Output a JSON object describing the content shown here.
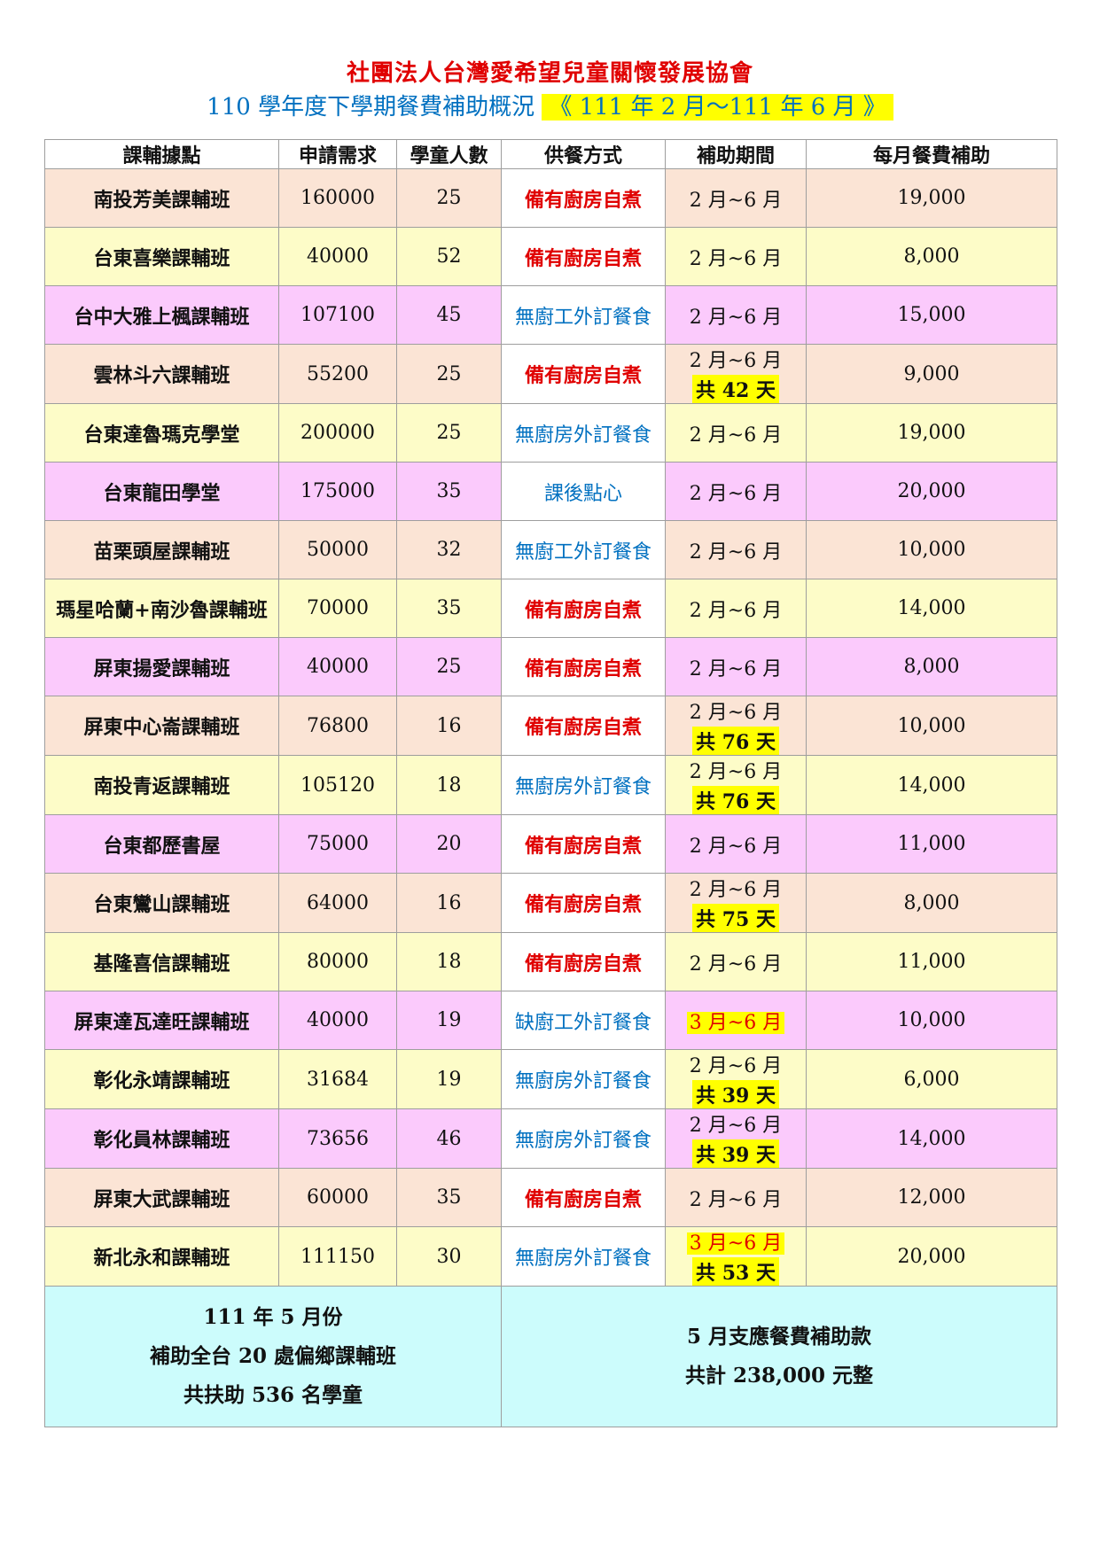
{
  "header": {
    "org": "社團法人台灣愛希望兒童關懷發展協會",
    "subtitle": "110 學年度下學期餐費補助概況",
    "period": "《 111 年 2 月～111 年 6 月 》"
  },
  "table": {
    "columns": [
      "課輔據點",
      "申請需求",
      "學童人數",
      "供餐方式",
      "補助期間",
      "每月餐費補助"
    ],
    "rows": [
      {
        "name": "南投芳美課輔班",
        "request": "160000",
        "students": "25",
        "meal": "備有廚房自煮",
        "meal_color": "red",
        "period": "2 月~6 月",
        "days": "",
        "period_hl": false,
        "monthly": "19,000",
        "band": "r0"
      },
      {
        "name": "台東喜樂課輔班",
        "request": "40000",
        "students": "52",
        "meal": "備有廚房自煮",
        "meal_color": "red",
        "period": "2 月~6 月",
        "days": "",
        "period_hl": false,
        "monthly": "8,000",
        "band": "r1"
      },
      {
        "name": "台中大雅上楓課輔班",
        "request": "107100",
        "students": "45",
        "meal": "無廚工外訂餐食",
        "meal_color": "blue",
        "period": "2 月~6 月",
        "days": "",
        "period_hl": false,
        "monthly": "15,000",
        "band": "r2"
      },
      {
        "name": "雲林斗六課輔班",
        "request": "55200",
        "students": "25",
        "meal": "備有廚房自煮",
        "meal_color": "red",
        "period": "2 月~6 月",
        "days": "共 42 天",
        "period_hl": false,
        "monthly": "9,000",
        "band": "r0"
      },
      {
        "name": "台東達魯瑪克學堂",
        "request": "200000",
        "students": "25",
        "meal": "無廚房外訂餐食",
        "meal_color": "blue",
        "period": "2 月~6 月",
        "days": "",
        "period_hl": false,
        "monthly": "19,000",
        "band": "r1"
      },
      {
        "name": "台東龍田學堂",
        "request": "175000",
        "students": "35",
        "meal": "課後點心",
        "meal_color": "blue",
        "period": "2 月~6 月",
        "days": "",
        "period_hl": false,
        "monthly": "20,000",
        "band": "r2"
      },
      {
        "name": "苗栗頭屋課輔班",
        "request": "50000",
        "students": "32",
        "meal": "無廚工外訂餐食",
        "meal_color": "blue",
        "period": "2 月~6 月",
        "days": "",
        "period_hl": false,
        "monthly": "10,000",
        "band": "r0"
      },
      {
        "name": "瑪星哈蘭+南沙魯課輔班",
        "request": "70000",
        "students": "35",
        "meal": "備有廚房自煮",
        "meal_color": "red",
        "period": "2 月~6 月",
        "days": "",
        "period_hl": false,
        "monthly": "14,000",
        "band": "r1"
      },
      {
        "name": "屏東揚愛課輔班",
        "request": "40000",
        "students": "25",
        "meal": "備有廚房自煮",
        "meal_color": "red",
        "period": "2 月~6 月",
        "days": "",
        "period_hl": false,
        "monthly": "8,000",
        "band": "r2"
      },
      {
        "name": "屏東中心崙課輔班",
        "request": "76800",
        "students": "16",
        "meal": "備有廚房自煮",
        "meal_color": "red",
        "period": "2 月~6 月",
        "days": "共 76 天",
        "period_hl": false,
        "monthly": "10,000",
        "band": "r0"
      },
      {
        "name": "南投青返課輔班",
        "request": "105120",
        "students": "18",
        "meal": "無廚房外訂餐食",
        "meal_color": "blue",
        "period": "2 月~6 月",
        "days": "共 76 天",
        "period_hl": false,
        "monthly": "14,000",
        "band": "r1"
      },
      {
        "name": "台東都歷書屋",
        "request": "75000",
        "students": "20",
        "meal": "備有廚房自煮",
        "meal_color": "red",
        "period": "2 月~6 月",
        "days": "",
        "period_hl": false,
        "monthly": "11,000",
        "band": "r2"
      },
      {
        "name": "台東鸞山課輔班",
        "request": "64000",
        "students": "16",
        "meal": "備有廚房自煮",
        "meal_color": "red",
        "period": "2 月~6 月",
        "days": "共 75 天",
        "period_hl": false,
        "monthly": "8,000",
        "band": "r0"
      },
      {
        "name": "基隆喜信課輔班",
        "request": "80000",
        "students": "18",
        "meal": "備有廚房自煮",
        "meal_color": "red",
        "period": "2 月~6 月",
        "days": "",
        "period_hl": false,
        "monthly": "11,000",
        "band": "r1"
      },
      {
        "name": "屏東達瓦達旺課輔班",
        "request": "40000",
        "students": "19",
        "meal": "缺廚工外訂餐食",
        "meal_color": "blue",
        "period": "3 月~6 月",
        "days": "",
        "period_hl": true,
        "monthly": "10,000",
        "band": "r2"
      },
      {
        "name": "彰化永靖課輔班",
        "request": "31684",
        "students": "19",
        "meal": "無廚房外訂餐食",
        "meal_color": "blue",
        "period": "2 月~6 月",
        "days": "共 39 天",
        "period_hl": false,
        "monthly": "6,000",
        "band": "r1"
      },
      {
        "name": "彰化員林課輔班",
        "request": "73656",
        "students": "46",
        "meal": "無廚房外訂餐食",
        "meal_color": "blue",
        "period": "2 月~6 月",
        "days": "共 39 天",
        "period_hl": false,
        "monthly": "14,000",
        "band": "r2"
      },
      {
        "name": "屏東大武課輔班",
        "request": "60000",
        "students": "35",
        "meal": "備有廚房自煮",
        "meal_color": "red",
        "period": "2 月~6 月",
        "days": "",
        "period_hl": false,
        "monthly": "12,000",
        "band": "r0"
      },
      {
        "name": "新北永和課輔班",
        "request": "111150",
        "students": "30",
        "meal": "無廚房外訂餐食",
        "meal_color": "blue",
        "period": "3 月~6 月",
        "days": "共 53 天",
        "period_hl": true,
        "monthly": "20,000",
        "band": "r1"
      }
    ]
  },
  "summary": {
    "left": [
      "111 年 5 月份",
      "補助全台 20 處偏鄉課輔班",
      "共扶助 536 名學童"
    ],
    "right": [
      "5 月支應餐費補助款",
      "共計 238,000 元整"
    ]
  }
}
